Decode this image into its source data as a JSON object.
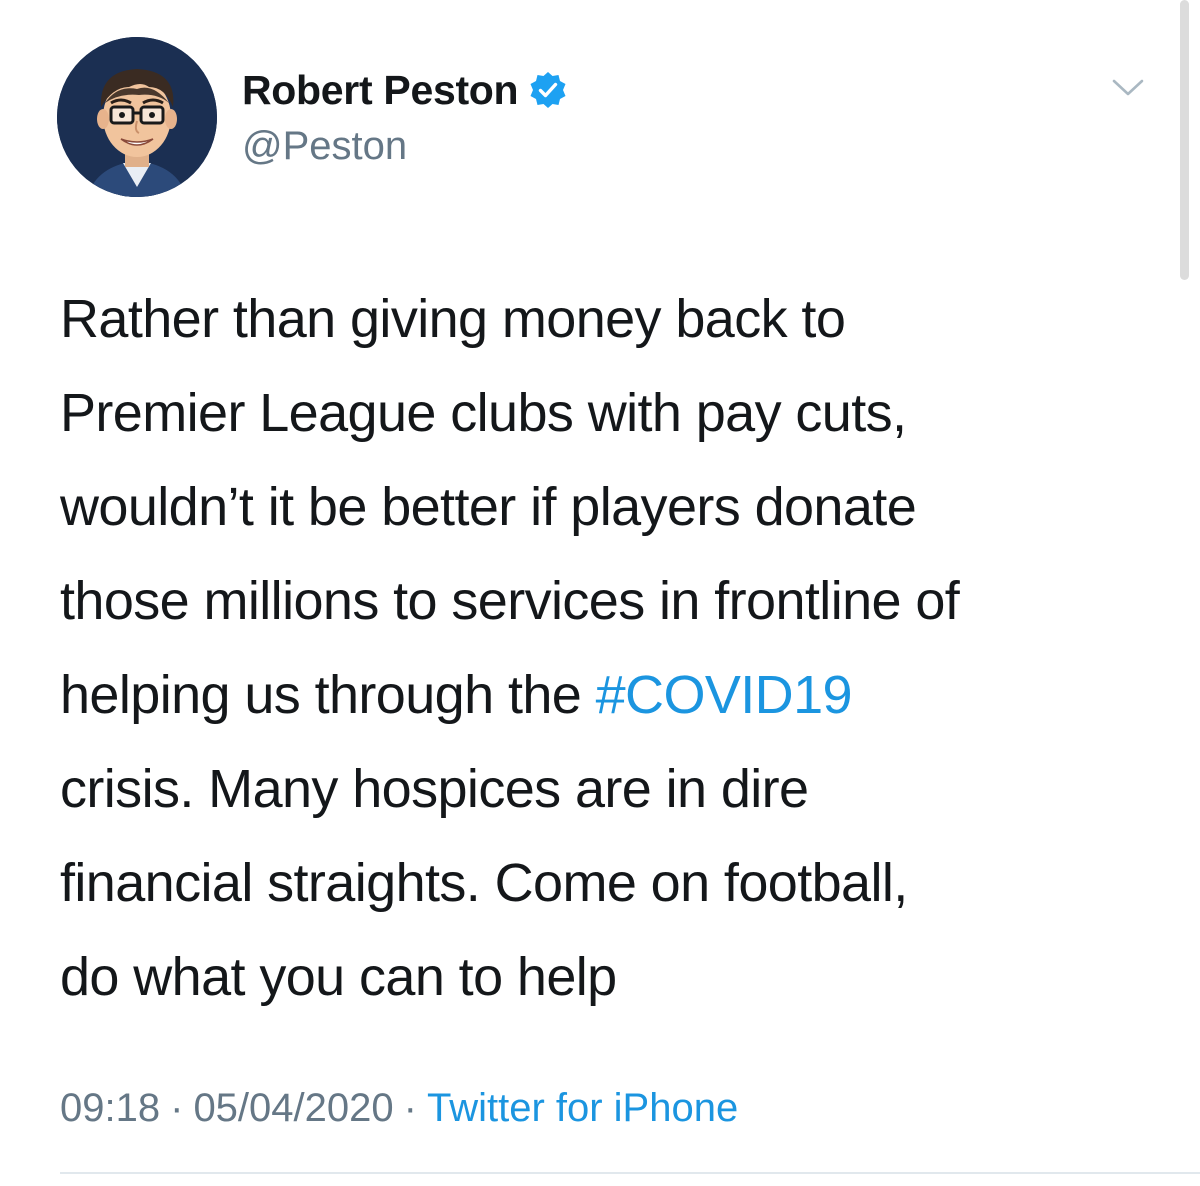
{
  "author": {
    "display_name": "Robert Peston",
    "handle": "@Peston",
    "verified": true,
    "avatar_icon": "cartoon-avatar-icon"
  },
  "tweet": {
    "lines": [
      "Rather than giving money back to",
      "Premier League clubs with pay cuts,",
      "wouldn’t it be better if players donate",
      "those millions to services in frontline of",
      "helping us through the ",
      "crisis. Many hospices are in dire",
      "financial straights. Come on football,",
      "do what you can to help"
    ],
    "hashtag": "#COVID19"
  },
  "meta": {
    "time": "09:18",
    "separator": "·",
    "date": "05/04/2020",
    "source": "Twitter for iPhone"
  },
  "colors": {
    "link": "#1b95e0",
    "secondary_text": "#657786",
    "primary_text": "#14171a",
    "avatar_bg": "#1b2f52",
    "verified_badge": "#1da1f2"
  },
  "icons": {
    "menu": "chevron-down-icon",
    "verified": "verified-badge-icon"
  }
}
